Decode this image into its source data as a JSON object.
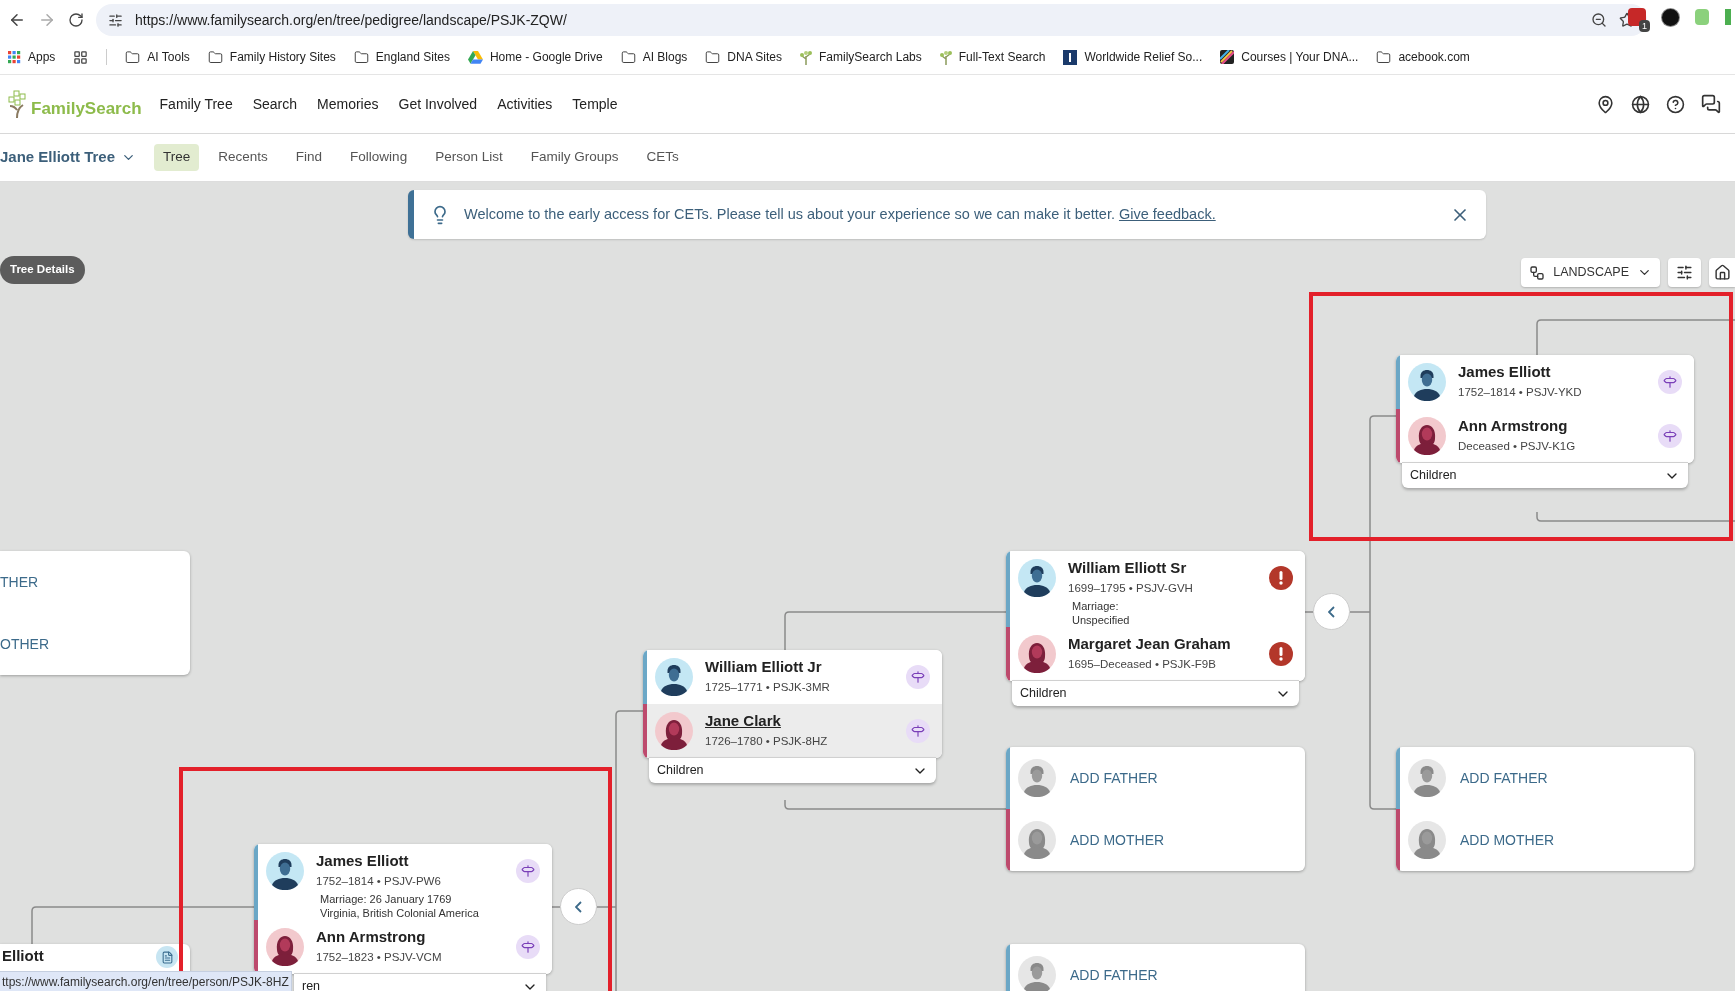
{
  "browser": {
    "url": "https://www.familysearch.org/en/tree/pedigree/landscape/PSJK-ZQW/",
    "extension_badge": "1",
    "bookmarks": [
      {
        "label": "Apps",
        "kind": "apps"
      },
      {
        "label": "AI Tools",
        "kind": "folder"
      },
      {
        "label": "Family History Sites",
        "kind": "folder"
      },
      {
        "label": "England Sites",
        "kind": "folder"
      },
      {
        "label": "Home - Google Drive",
        "kind": "drive"
      },
      {
        "label": "AI Blogs",
        "kind": "folder"
      },
      {
        "label": "DNA Sites",
        "kind": "folder"
      },
      {
        "label": "FamilySearch Labs",
        "kind": "tree"
      },
      {
        "label": "Full-Text Search",
        "kind": "tree"
      },
      {
        "label": "Worldwide Relief So...",
        "kind": "emblem"
      },
      {
        "label": "Courses | Your DNA...",
        "kind": "stripes"
      },
      {
        "label": "acebook.com",
        "kind": "folder"
      }
    ]
  },
  "header": {
    "logo": "FamilySearch",
    "nav": [
      "Family Tree",
      "Search",
      "Memories",
      "Get Involved",
      "Activities",
      "Temple"
    ]
  },
  "subnav": {
    "tree_name": "Jane Elliott Tree",
    "tabs": [
      {
        "label": "Tree",
        "selected": true
      },
      {
        "label": "Recents",
        "selected": false
      },
      {
        "label": "Find",
        "selected": false
      },
      {
        "label": "Following",
        "selected": false
      },
      {
        "label": "Person List",
        "selected": false
      },
      {
        "label": "Family Groups",
        "selected": false
      },
      {
        "label": "CETs",
        "selected": false
      }
    ]
  },
  "banner": {
    "message": "Welcome to the early access for CETs. Please tell us about your experience so we can make it better.",
    "link": "Give feedback."
  },
  "tree_details": "Tree Details",
  "view": {
    "layout": "LANDSCAPE"
  },
  "cards": [
    {
      "kind": "couple",
      "persons": [
        {
          "name": "James Elliott",
          "details": "1752–1814 • PSJV-YKD",
          "kind": "male",
          "alert": false,
          "hovered": false
        },
        {
          "name": "Ann Armstrong",
          "details": "Deceased • PSJV-K1G",
          "kind": "female",
          "alert": false,
          "hovered": false
        }
      ],
      "children_label": "Children"
    },
    {
      "kind": "couple",
      "persons": [
        {
          "name": "William Elliott Sr",
          "details": "1699–1795 • PSJV-GVH",
          "kind": "male",
          "alert": true,
          "hovered": false
        },
        {
          "name": "Margaret Jean Graham",
          "details": "1695–Deceased • PSJK-F9B",
          "kind": "female",
          "alert": true,
          "hovered": false
        }
      ],
      "marriage": [
        "Marriage:",
        "Unspecified"
      ],
      "children_label": "Children"
    },
    {
      "kind": "couple",
      "persons": [
        {
          "name": "William Elliott Jr",
          "details": "1725–1771 • PSJK-3MR",
          "kind": "male",
          "alert": false,
          "hovered": false
        },
        {
          "name": "Jane Clark",
          "details": "1726–1780 • PSJK-8HZ",
          "kind": "female",
          "alert": false,
          "hovered": true
        }
      ],
      "children_label": "Children"
    },
    {
      "kind": "add",
      "rows": [
        {
          "label": "ADD FATHER",
          "kind": "male"
        },
        {
          "label": "ADD MOTHER",
          "kind": "female"
        }
      ]
    },
    {
      "kind": "add",
      "rows": [
        {
          "label": "ADD FATHER",
          "kind": "male"
        },
        {
          "label": "ADD MOTHER",
          "kind": "female"
        }
      ]
    },
    {
      "kind": "add",
      "rows": [
        {
          "label": "ADD FATHER",
          "kind": "male"
        }
      ]
    },
    {
      "kind": "fragment",
      "lines": [
        "THER",
        "OTHER"
      ]
    },
    {
      "kind": "couple",
      "persons": [
        {
          "name": "James Elliott",
          "details": "1752–1814 • PSJV-PW6",
          "kind": "male",
          "alert": false,
          "hovered": false
        },
        {
          "name": "Ann Armstrong",
          "details": "1752–1823 • PSJV-VCM",
          "kind": "female",
          "alert": false,
          "hovered": false
        }
      ],
      "marriage": [
        "Marriage: 26 January 1769",
        "Virginia, British Colonial America"
      ],
      "children_label": "ren"
    },
    {
      "kind": "partial_person",
      "name": "Elliott"
    }
  ],
  "status_url": "ttps://www.familysearch.org/en/tree/person/PSJK-8HZ"
}
